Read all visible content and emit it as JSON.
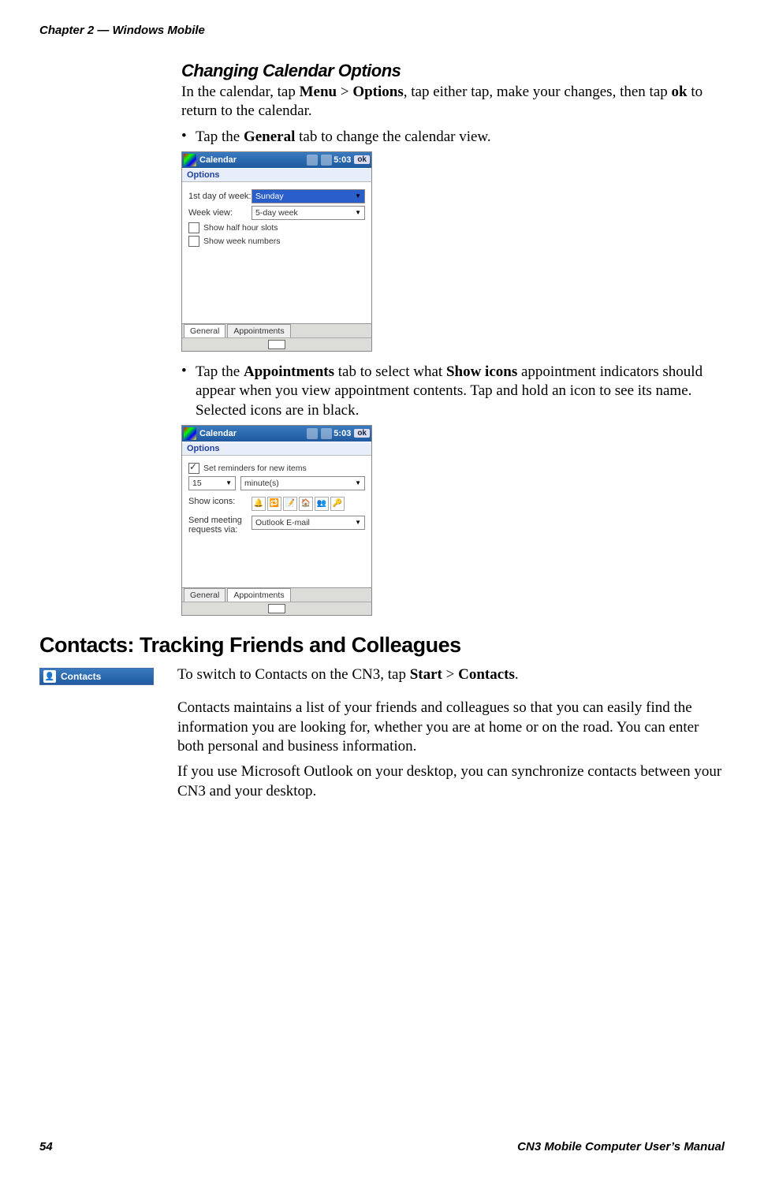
{
  "header": {
    "chapter": "Chapter 2 — Windows Mobile"
  },
  "section1": {
    "title": "Changing Calendar Options",
    "intro_a": "In the calendar, tap ",
    "intro_menu": "Menu",
    "intro_gt1": " > ",
    "intro_options": "Options",
    "intro_b": ", tap either tap, make your changes, then tap ",
    "intro_ok": "ok",
    "intro_c": " to return to the calendar.",
    "bullet1_a": "Tap the ",
    "bullet1_b": "General",
    "bullet1_c": " tab to change the calendar view.",
    "bullet2_a": "Tap the ",
    "bullet2_b": "Appointments",
    "bullet2_c": " tab to select what ",
    "bullet2_d": "Show icons",
    "bullet2_e": " appointment indicators should appear when you view appointment contents. Tap and hold an icon to see its name. Selected icons are in black."
  },
  "shot_common": {
    "app": "Calendar",
    "time": "5:03",
    "ok": "ok",
    "sub": "Options",
    "tab_general": "General",
    "tab_appts": "Appointments"
  },
  "shot1": {
    "row1_label": "1st day of week:",
    "row1_value": "Sunday",
    "row2_label": "Week view:",
    "row2_value": "5-day week",
    "chk1": "Show half hour slots",
    "chk2": "Show week numbers"
  },
  "shot2": {
    "chk1": "Set reminders for new items",
    "rem_val": "15",
    "rem_unit": "minute(s)",
    "row_icons": "Show icons:",
    "row_send1": "Send meeting",
    "row_send2": "requests via:",
    "send_val": "Outlook E-mail"
  },
  "section2": {
    "title": "Contacts: Tracking Friends and Colleagues",
    "icon_label": "Contacts",
    "p1_a": "To switch to Contacts on the CN3, tap ",
    "p1_b": "Start",
    "p1_gt": " > ",
    "p1_c": "Contacts",
    "p1_d": ".",
    "p2": "Contacts maintains a list of your friends and colleagues so that you can easily find the information you are looking for, whether you are at home or on the road. You can enter both personal and business information.",
    "p3": "If you use Microsoft Outlook on your desktop, you can synchronize contacts between your CN3 and your desktop."
  },
  "footer": {
    "page": "54",
    "manual": "CN3 Mobile Computer User’s Manual"
  }
}
